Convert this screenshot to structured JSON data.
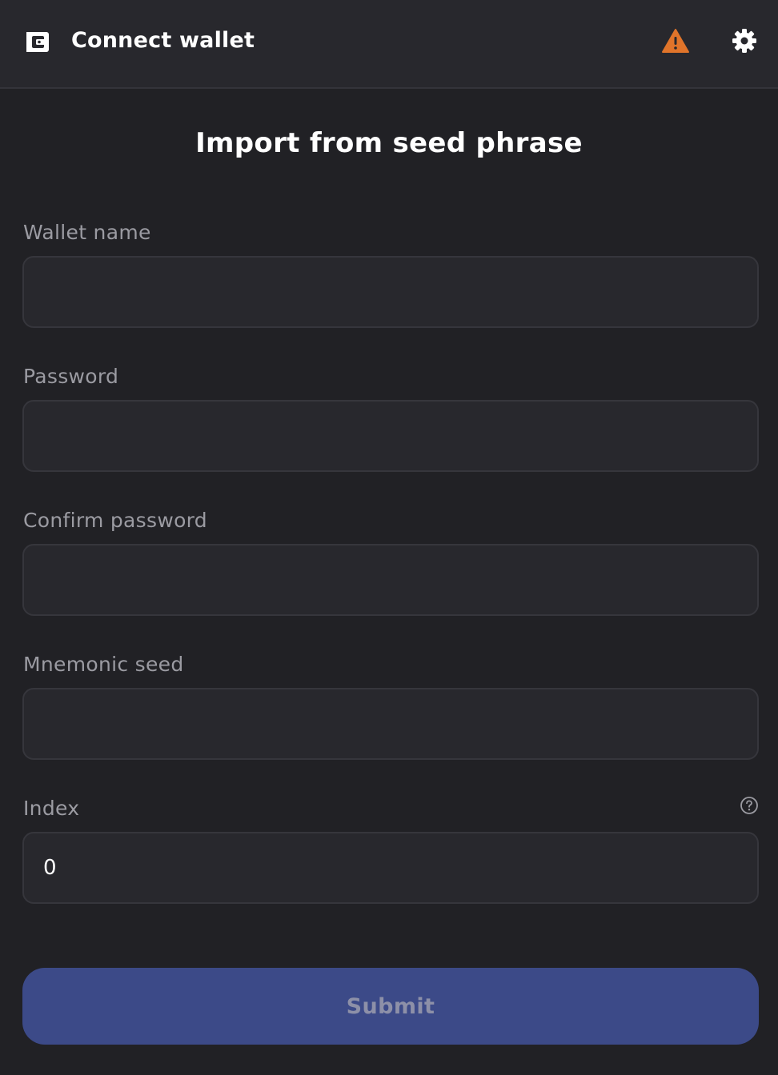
{
  "header": {
    "title": "Connect wallet",
    "icons": {
      "left": "wallet-icon",
      "warning": "warning-icon",
      "settings": "gear-icon"
    },
    "warning_color": "#e0742a"
  },
  "page_title": "Import from seed phrase",
  "form": {
    "wallet_name": {
      "label": "Wallet name",
      "value": ""
    },
    "password": {
      "label": "Password",
      "value": ""
    },
    "confirm_password": {
      "label": "Confirm password",
      "value": ""
    },
    "mnemonic_seed": {
      "label": "Mnemonic seed",
      "value": ""
    },
    "index": {
      "label": "Index",
      "value": "0",
      "help_icon": "help-icon"
    }
  },
  "submit": {
    "label": "Submit",
    "color": "#3c4a88"
  }
}
